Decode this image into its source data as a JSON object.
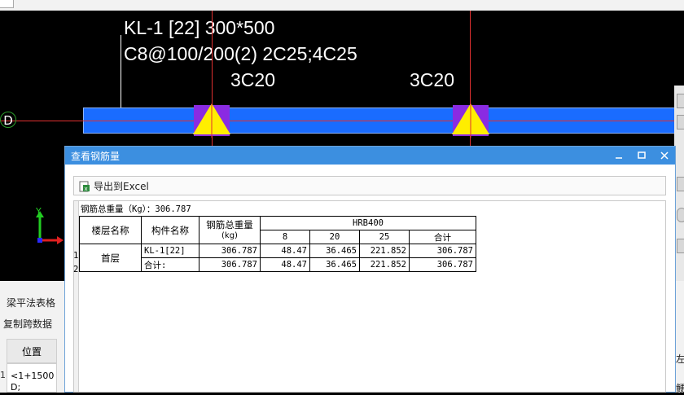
{
  "cad": {
    "beam_label": "KL-1 [22] 300*500",
    "beam_spec": "C8@100/200(2) 2C25;4C25",
    "top_rebar_left": "3C20",
    "top_rebar_right": "3C20",
    "axis_label": "D",
    "beam_color": "#1a6cff"
  },
  "right_panel": {
    "tab_left": "左",
    "tab_bottom": "鲠"
  },
  "bottom_panel": {
    "tab_table": "梁平法表格",
    "tab_copy": "复制跨数据",
    "column_header": "位置",
    "row1_num": "1",
    "row1_value": "<1+1500",
    "row2_value": "D;"
  },
  "dialog": {
    "title": "查看钢筋量",
    "export_button": "导出到Excel",
    "total_weight": "钢筋总重量（Kg）：306.787",
    "table": {
      "floor_header": "楼层名称",
      "member_header": "构件名称",
      "total_header": "钢筋总重量",
      "unit_header": "(kg)",
      "grade": "HRB400",
      "diameters": [
        "8",
        "20",
        "25",
        "合计"
      ],
      "floor_name": "首层",
      "rows": [
        {
          "num": "1",
          "member": "KL-1[22]",
          "total": "306.787",
          "d8": "48.47",
          "d20": "36.465",
          "d25": "221.852",
          "sum": "306.787"
        },
        {
          "num": "2",
          "member": "合计:",
          "total": "306.787",
          "d8": "48.47",
          "d20": "36.465",
          "d25": "221.852",
          "sum": "306.787"
        }
      ]
    }
  }
}
